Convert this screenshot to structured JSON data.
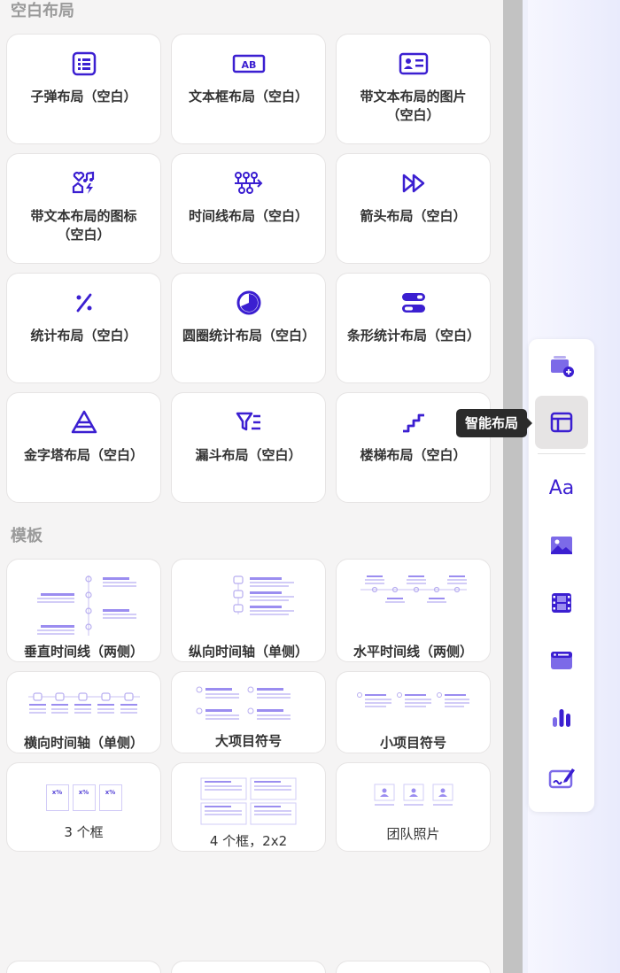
{
  "colors": {
    "accent": "#3b1fd1",
    "accent_light": "#9b8df0",
    "tooltip_bg": "#2b2b2b"
  },
  "sections": {
    "blank_title": "空白布局",
    "template_title": "模板"
  },
  "blank_layouts": [
    {
      "label": "子弹布局（空白）",
      "icon": "bullet-list-icon"
    },
    {
      "label": "文本框布局（空白）",
      "icon": "textbox-ab-icon"
    },
    {
      "label": "带文本布局的图片（空白）",
      "icon": "image-text-card-icon"
    },
    {
      "label": "带文本布局的图标（空白）",
      "icon": "icon-set-icon"
    },
    {
      "label": "时间线布局（空白）",
      "icon": "timeline-icon"
    },
    {
      "label": "箭头布局（空白）",
      "icon": "double-arrow-icon"
    },
    {
      "label": "统计布局（空白）",
      "icon": "percent-icon"
    },
    {
      "label": "圆圈统计布局（空白）",
      "icon": "pie-circle-icon"
    },
    {
      "label": "条形统计布局（空白）",
      "icon": "bar-toggle-icon"
    },
    {
      "label": "金字塔布局（空白）",
      "icon": "pyramid-icon"
    },
    {
      "label": "漏斗布局（空白）",
      "icon": "funnel-icon"
    },
    {
      "label": "楼梯布局（空白）",
      "icon": "stairs-icon"
    }
  ],
  "templates": [
    {
      "label": "垂直时间线（两侧）"
    },
    {
      "label": "纵向时间轴（单侧）"
    },
    {
      "label": "水平时间线（两侧）"
    },
    {
      "label": "横向时间轴（单侧）"
    },
    {
      "label": "大项目符号"
    },
    {
      "label": "小项目符号"
    },
    {
      "label": "3 个框",
      "box_text": "x%"
    },
    {
      "label": "4 个框，2x2"
    },
    {
      "label": "团队照片"
    }
  ],
  "toolbar": {
    "tooltip": "智能布局",
    "items": [
      {
        "icon": "add-slide-icon"
      },
      {
        "icon": "smart-layout-icon",
        "active": true
      },
      {
        "icon": "text-style-icon",
        "text": "Aa"
      },
      {
        "icon": "image-icon"
      },
      {
        "icon": "video-film-icon"
      },
      {
        "icon": "embed-window-icon"
      },
      {
        "icon": "chart-icon"
      },
      {
        "icon": "edit-draw-icon"
      }
    ]
  }
}
